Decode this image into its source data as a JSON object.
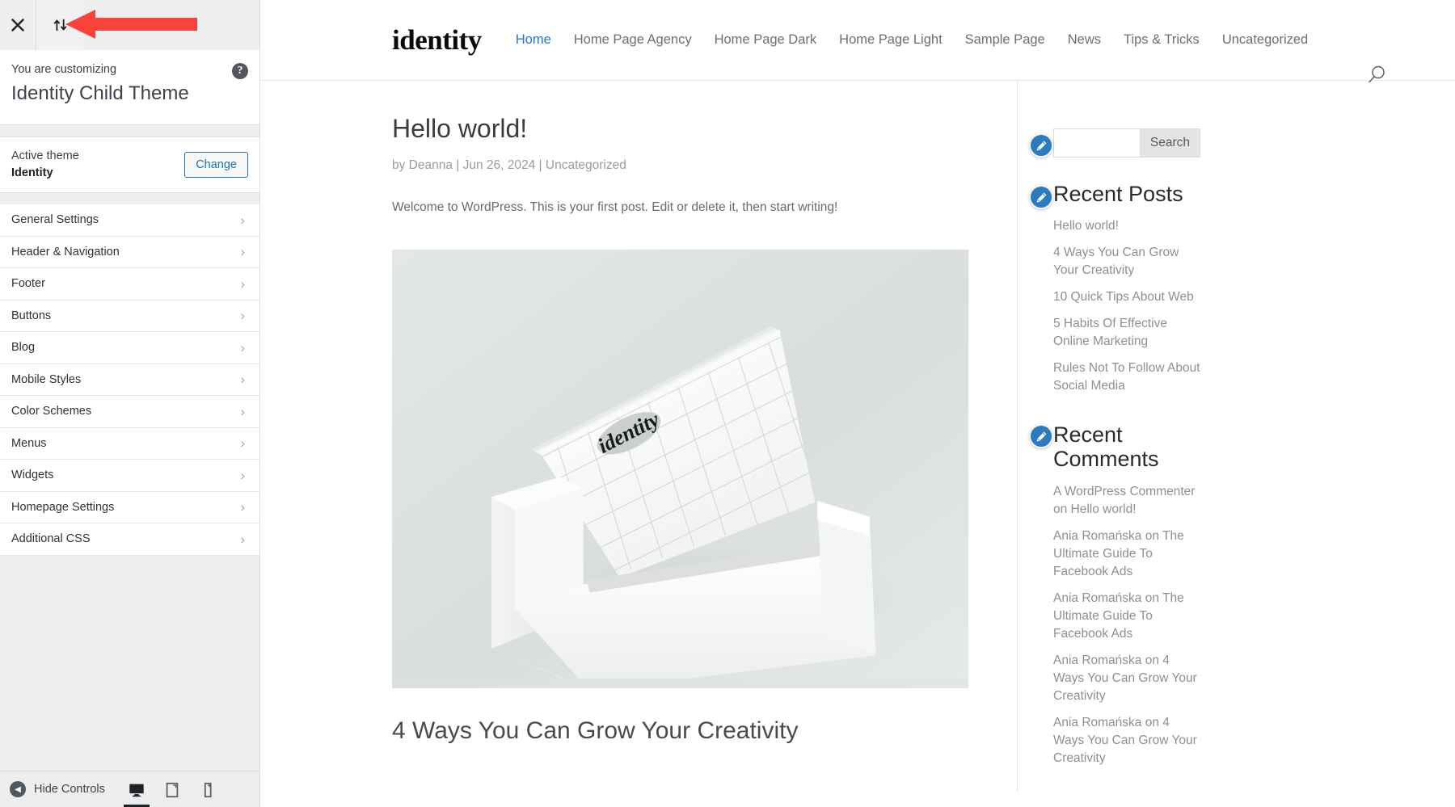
{
  "customizer": {
    "topbar": {
      "close_label": "Close customizer",
      "close_icon": "close-icon",
      "collapse_label": "Collapse sidebar",
      "collapse_icon": "arrows-up-down-icon"
    },
    "header": {
      "eyebrow": "You are customizing",
      "title": "Identity Child Theme",
      "help_icon": "help-circle-icon",
      "help_label": "?"
    },
    "theme": {
      "label": "Active theme",
      "name": "Identity",
      "change_label": "Change"
    },
    "sections": [
      {
        "label": "General Settings",
        "icon": "chevron-right-icon"
      },
      {
        "label": "Header & Navigation",
        "icon": "chevron-right-icon"
      },
      {
        "label": "Footer",
        "icon": "chevron-right-icon"
      },
      {
        "label": "Buttons",
        "icon": "chevron-right-icon"
      },
      {
        "label": "Blog",
        "icon": "chevron-right-icon"
      },
      {
        "label": "Mobile Styles",
        "icon": "chevron-right-icon"
      },
      {
        "label": "Color Schemes",
        "icon": "chevron-right-icon"
      },
      {
        "label": "Menus",
        "icon": "chevron-right-icon"
      },
      {
        "label": "Widgets",
        "icon": "chevron-right-icon"
      },
      {
        "label": "Homepage Settings",
        "icon": "chevron-right-icon"
      },
      {
        "label": "Additional CSS",
        "icon": "chevron-right-icon"
      }
    ],
    "footer": {
      "hide_controls_label": "Hide Controls",
      "hide_controls_icon": "caret-left-circle-icon",
      "devices": [
        {
          "name": "desktop",
          "icon": "desktop-icon",
          "active": true
        },
        {
          "name": "tablet",
          "icon": "tablet-icon",
          "active": false
        },
        {
          "name": "mobile",
          "icon": "mobile-icon",
          "active": false
        }
      ]
    },
    "annotation": {
      "type": "red-arrow",
      "color": "#f9423a",
      "points_to": "collapse-sidebar-button"
    }
  },
  "preview": {
    "site": {
      "logo_text": "identity",
      "nav": [
        {
          "label": "Home",
          "current": true
        },
        {
          "label": "Home Page Agency",
          "current": false
        },
        {
          "label": "Home Page Dark",
          "current": false
        },
        {
          "label": "Home Page Light",
          "current": false
        },
        {
          "label": "Sample Page",
          "current": false
        },
        {
          "label": "News",
          "current": false
        },
        {
          "label": "Tips & Tricks",
          "current": false
        },
        {
          "label": "Uncategorized",
          "current": false
        }
      ],
      "search_icon": "search-icon"
    },
    "post": {
      "title": "Hello world!",
      "meta": "by Deanna  |  Jun 26, 2024  |  Uncategorized",
      "body": "Welcome to WordPress. This is your first post. Edit or delete it, then start writing!",
      "featured_image_alt": "identity business card holder mockup",
      "featured_image_logo": "identity",
      "next_post_title": "4 Ways You Can Grow Your Creativity"
    },
    "widgets": {
      "edit_icon": "pencil-edit-icon",
      "search": {
        "value": "",
        "placeholder": "",
        "submit_label": "Search"
      },
      "recent_posts": {
        "title": "Recent Posts",
        "items": [
          "Hello world!",
          "4 Ways You Can Grow Your Creativity",
          "10 Quick Tips About Web",
          "5 Habits Of Effective Online Marketing",
          "Rules Not To Follow About Social Media"
        ]
      },
      "recent_comments": {
        "title": "Recent Comments",
        "items": [
          "A WordPress Commenter on Hello world!",
          "Ania Romańska on The Ultimate Guide To Facebook Ads",
          "Ania Romańska on The Ultimate Guide To Facebook Ads",
          "Ania Romańska on 4 Ways You Can Grow Your Creativity",
          "Ania Romańska on 4 Ways You Can Grow Your Creativity"
        ]
      }
    }
  },
  "colors": {
    "accent_link": "#2277cc",
    "wp_blue": "#2271b1",
    "edit_pencil": "#2a7bc0",
    "arrow_red": "#f9423a",
    "sidebar_bg": "#eeeeee"
  }
}
